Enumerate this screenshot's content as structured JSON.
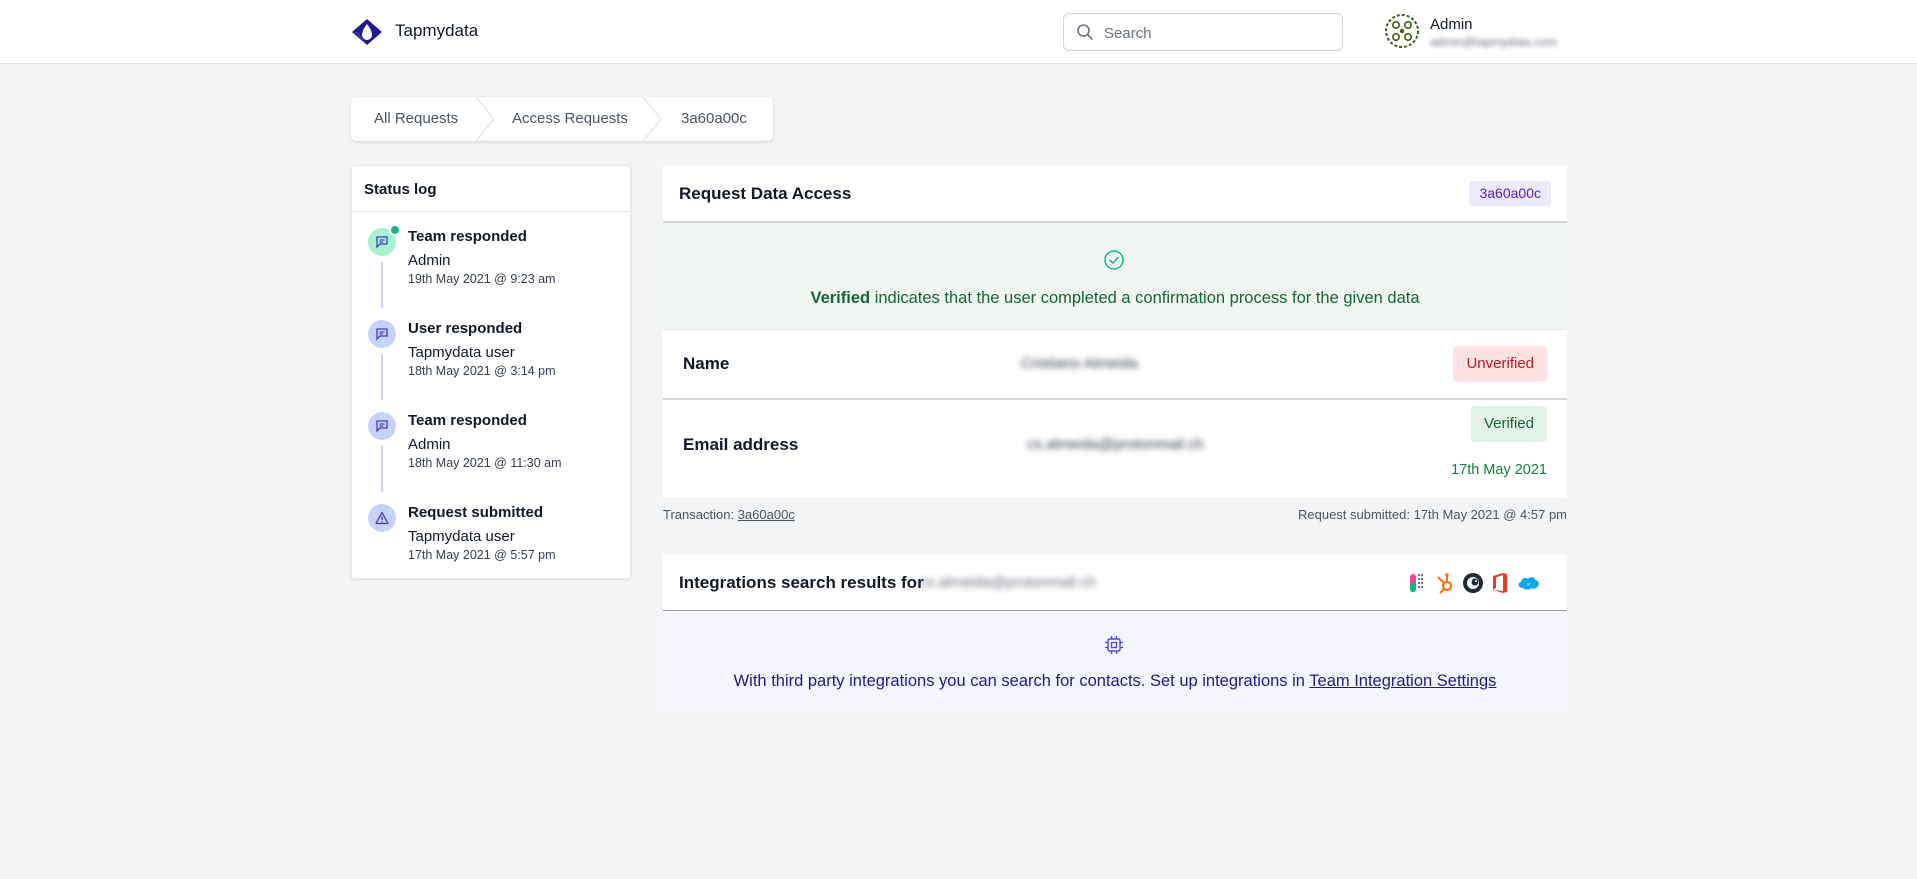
{
  "header": {
    "app_name": "Tapmydata",
    "search_placeholder": "Search",
    "user": {
      "name": "Admin",
      "email": "admin@tapmydata.com"
    }
  },
  "breadcrumb": [
    "All Requests",
    "Access Requests",
    "3a60a00c"
  ],
  "status_log": {
    "title": "Status log",
    "items": [
      {
        "title": "Team responded",
        "who": "Admin",
        "date": "19th May 2021 @ 9:23 am",
        "icon": "chat-icon",
        "color": "#a7f3d0",
        "active": true
      },
      {
        "title": "User responded",
        "who": "Tapmydata user",
        "date": "18th May 2021 @ 3:14 pm",
        "icon": "chat-icon",
        "color": "#c7d2fe"
      },
      {
        "title": "Team responded",
        "who": "Admin",
        "date": "18th May 2021 @ 11:30 am",
        "icon": "chat-icon",
        "color": "#c7d2fe"
      },
      {
        "title": "Request submitted",
        "who": "Tapmydata user",
        "date": "17th May 2021 @ 5:57 pm",
        "icon": "warning-triangle-icon",
        "color": "#c7d2fe"
      }
    ]
  },
  "request": {
    "title": "Request Data Access",
    "id": "3a60a00c",
    "note_bold": "Verified",
    "note_rest": " indicates that the user completed a confirmation process for the given data",
    "rows": [
      {
        "label": "Name",
        "value": "Cristiano Almeida",
        "status": "Unverified"
      },
      {
        "label": "Email address",
        "value": "cs.almeida@protonmail.ch",
        "status": "Verified",
        "verified_date": "17th May 2021"
      }
    ],
    "transaction_label": "Transaction:",
    "transaction_id": "3a60a00c",
    "submitted": "Request submitted: 17th May 2021 @ 4:57 pm"
  },
  "integrations": {
    "title": "Integrations search results for",
    "email": "cs.almeida@protonmail.ch",
    "logos": [
      "intercom-icon",
      "hubspot-icon",
      "mailchimp-icon",
      "office-icon",
      "salesforce-icon"
    ],
    "text": "With third party integrations you can search for contacts. Set up integrations in ",
    "link": "Team Integration Settings"
  },
  "colors": {
    "accent": "#5b21b6",
    "verified": "#166534",
    "unverified": "#b91c1c",
    "log_active": "#10b981"
  }
}
